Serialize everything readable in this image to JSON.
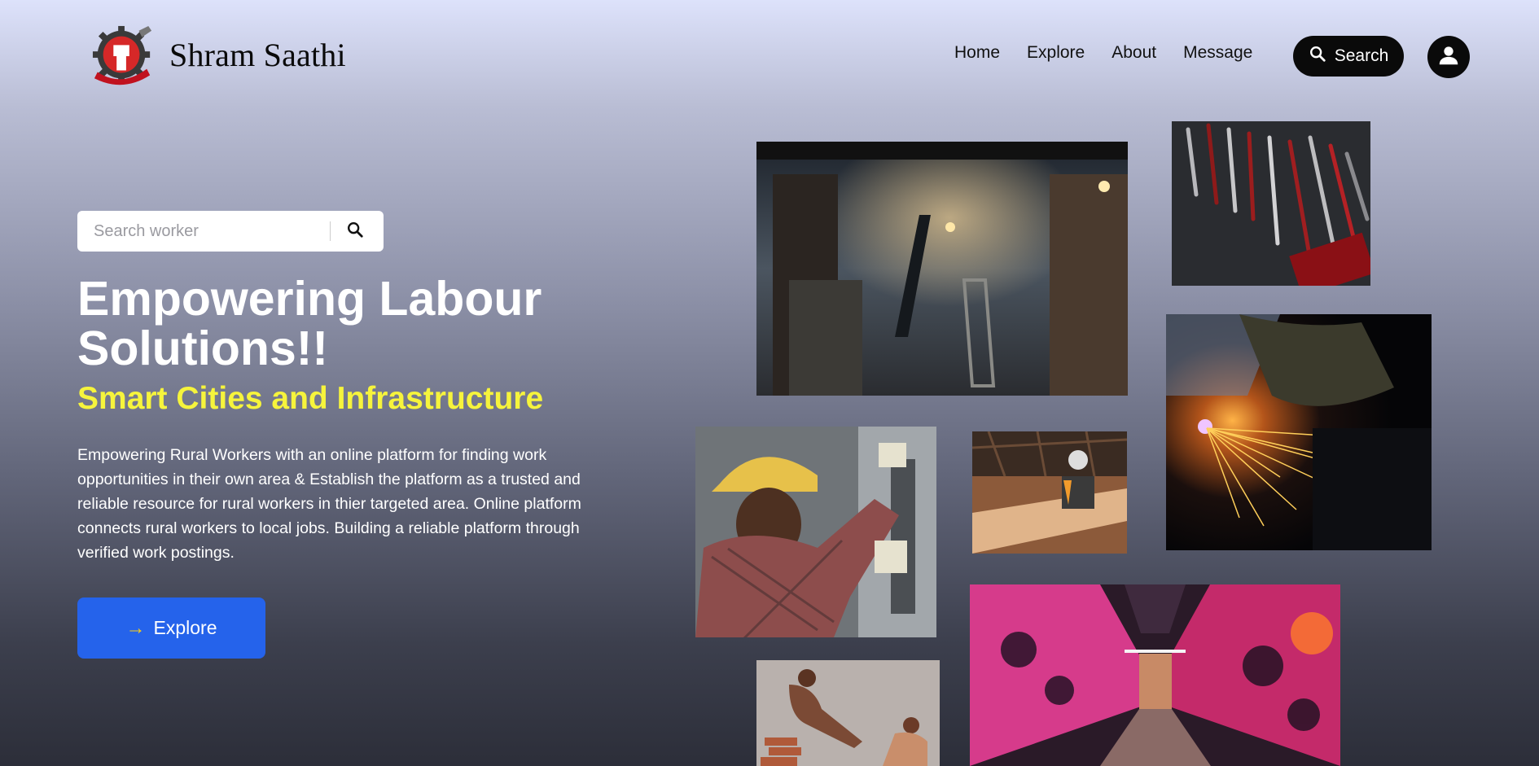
{
  "header": {
    "brand": "Shram Saathi",
    "logo_icon": "raised-fist-gear-logo",
    "nav": [
      "Home",
      "Explore",
      "About",
      "Message"
    ],
    "search_label": "Search",
    "search_icon": "search-icon",
    "profile_icon": "user-icon"
  },
  "hero": {
    "worker_search_placeholder": "Search worker",
    "headline": "Empowering Labour Solutions!!",
    "subheadline": "Smart Cities and Infrastructure",
    "description": "Empowering Rural Workers with an online platform for finding work opportunities in their own area & Establish the platform as a trusted and reliable resource for rural workers in thier targeted area. Online platform connects rural workers to local jobs. Building a reliable platform through verified work postings.",
    "explore_label": "Explore",
    "explore_icon": "arrow-right-icon"
  },
  "colors": {
    "accent_blue": "#2563eb",
    "accent_yellow": "#f6f43c",
    "dark": "#0a0a0a"
  },
  "gallery": [
    "construction-worker-ladder-photo",
    "tool-rack-photo",
    "electrician-hardhat-photo",
    "woodworker-photo",
    "plasma-cutting-sparks-photo",
    "graffiti-tunnel-photo",
    "brick-passing-photo"
  ]
}
